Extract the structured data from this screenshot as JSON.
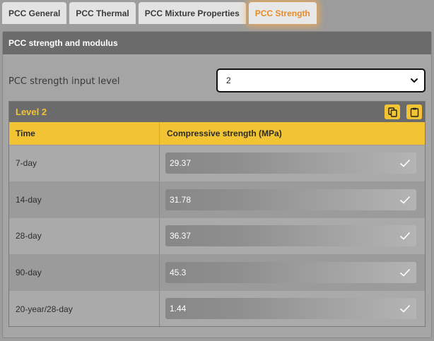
{
  "tabs": [
    {
      "label": "PCC General",
      "active": false
    },
    {
      "label": "PCC Thermal",
      "active": false
    },
    {
      "label": "PCC Mixture Properties",
      "active": false
    },
    {
      "label": "PCC Strength",
      "active": true
    }
  ],
  "panel": {
    "title": "PCC strength and modulus",
    "input_level_label": "PCC strength input level",
    "input_level_value": "2"
  },
  "level": {
    "title": "Level 2",
    "copy_icon": "copy-icon",
    "paste_icon": "clipboard-icon"
  },
  "table": {
    "columns": [
      "Time",
      "Compressive strength (MPa)"
    ],
    "rows": [
      {
        "time": "7-day",
        "value": "29.37"
      },
      {
        "time": "14-day",
        "value": "31.78"
      },
      {
        "time": "28-day",
        "value": "36.37"
      },
      {
        "time": "90-day",
        "value": "45.3"
      },
      {
        "time": "20-year/28-day",
        "value": "1.44"
      }
    ]
  },
  "colors": {
    "accent": "#f2c433",
    "active_tab_text": "#e88a25",
    "header_bg": "#6b6b6b"
  }
}
